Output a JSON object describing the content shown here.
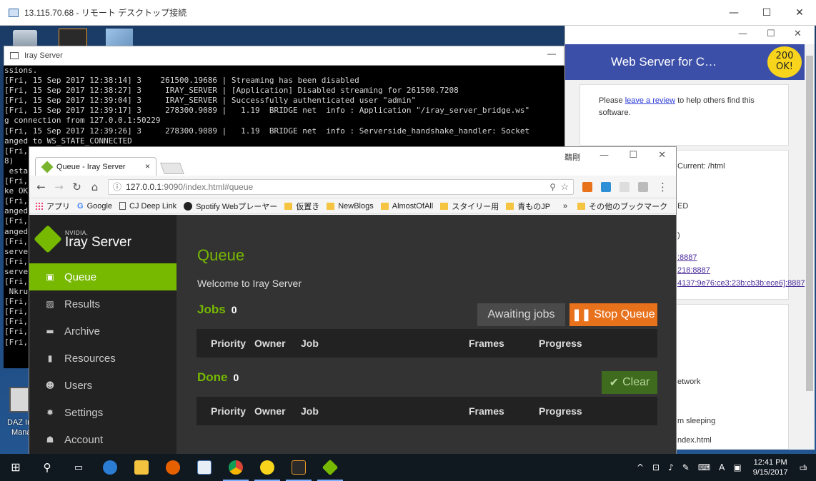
{
  "rdp": {
    "title": "13.115.70.68 - リモート デスクトップ接続"
  },
  "desktop": {
    "daz_label_1": "DAZ Ir",
    "daz_label_2": "Mana"
  },
  "console": {
    "title": "Iray Server",
    "lines": [
      "ssions.",
      "[Fri, 15 Sep 2017 12:38:14] 3    261500.19686 | Streaming has been disabled",
      "[Fri, 15 Sep 2017 12:38:27] 3     IRAY_SERVER | [Application] Disabled streaming for 261500.7208",
      "[Fri, 15 Sep 2017 12:39:04] 3     IRAY_SERVER | Successfully authenticated user \"admin\"",
      "[Fri, 15 Sep 2017 12:39:17] 3     278300.9089 |   1.19  BRIDGE net  info : Application \"/iray_server_bridge.ws\"",
      "g connection from 127.0.0.1:50229",
      "[Fri, 15 Sep 2017 12:39:26] 3     278300.9089 |   1.19  BRIDGE net  info : Serverside_handshake_handler: Socket",
      "anged to WS_STATE_CONNECTED",
      "[Fri,",
      "8)",
      " esta",
      "[Fri,",
      "ke OK",
      "[Fri,",
      "anged",
      "[Fri,",
      "anged",
      "[Fri,",
      "serve",
      "[Fri,",
      "serve",
      "[Fri,",
      " Nkru",
      "[Fri,",
      "[Fri,",
      "[Fri,",
      "[Fri,",
      "[Fri,"
    ]
  },
  "webserver": {
    "title": "Web Server for C…",
    "badge_line1": "200",
    "badge_line2": "OK!",
    "review_prefix": "Please ",
    "review_link": "leave a review",
    "review_suffix": " to help others find this software.",
    "frag_current": "Current: /html",
    "frag_ed": "ED",
    "frag_paren": ")",
    "frag_port1": ":8887",
    "frag_port2": "218:8887",
    "frag_port3": "4137:9e76:ce3:23b:cb3b:ece6]:8887",
    "frag_network": "etwork",
    "frag_sleeping": "m sleeping",
    "frag_index": "ndex.html"
  },
  "chrome": {
    "tab_title": "Queue - Iray Server",
    "tab_close": "×",
    "window_label": "鵜剛",
    "url_host": "127.0.0.1",
    "url_path": ":9090/index.html#queue",
    "bookmarks": [
      "アプリ",
      "Google",
      "CJ Deep Link",
      "Spotify Webプレーヤー",
      "仮置き",
      "NewBlogs",
      "AlmostOfAll",
      "スタイリー用",
      "青ものJP"
    ],
    "more": "»",
    "other_bookmarks": "その他のブックマーク"
  },
  "app": {
    "brand_small": "NVIDIA.",
    "brand": "Iray Server",
    "menu": [
      {
        "label": "Queue",
        "icon": "queue-icon",
        "glyph": "▣"
      },
      {
        "label": "Results",
        "icon": "results-icon",
        "glyph": "▨"
      },
      {
        "label": "Archive",
        "icon": "archive-icon",
        "glyph": "▬"
      },
      {
        "label": "Resources",
        "icon": "resources-icon",
        "glyph": "▮"
      },
      {
        "label": "Users",
        "icon": "users-icon",
        "glyph": "☻"
      },
      {
        "label": "Settings",
        "icon": "settings-icon",
        "glyph": "✹"
      },
      {
        "label": "Account",
        "icon": "account-icon",
        "glyph": "☗"
      }
    ],
    "page_title": "Queue",
    "welcome": "Welcome to Iray Server",
    "jobs_label": "Jobs",
    "jobs_count": "0",
    "await_btn": "Awaiting jobs",
    "stop_btn": "Stop Queue",
    "done_label": "Done",
    "done_count": "0",
    "clear_btn": "Clear",
    "columns": {
      "priority": "Priority",
      "owner": "Owner",
      "job": "Job",
      "frames": "Frames",
      "progress": "Progress"
    },
    "accent": "#76b900",
    "stop_color": "#e8711c"
  },
  "taskbar": {
    "time": "12:41 PM",
    "date": "9/15/2017",
    "ime": "A",
    "notif": "1"
  }
}
